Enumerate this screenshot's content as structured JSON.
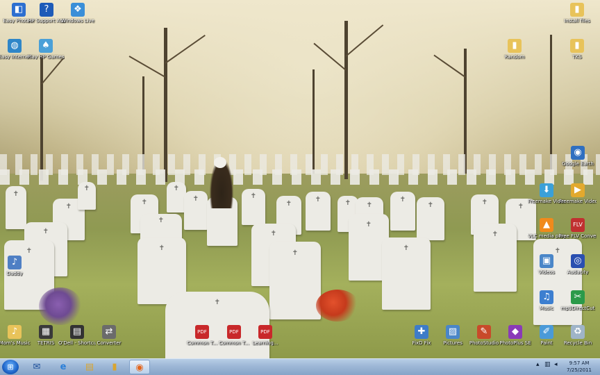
{
  "desktop_icons_left": [
    {
      "label": "Easy Photo...",
      "icon": "easy-photo-icon",
      "color": "#2d6fd0"
    },
    {
      "label": "HP Support Assistant",
      "icon": "hp-support-icon",
      "color": "#1e5bb8"
    },
    {
      "label": "Windows Live",
      "icon": "windows-live-icon",
      "color": "#3a8fd8"
    },
    {
      "label": "Easy Internet",
      "icon": "easy-internet-icon",
      "color": "#2f86c8"
    },
    {
      "label": "Play HP Games",
      "icon": "hp-games-icon",
      "color": "#4aa0d8"
    },
    {
      "label": "Daddy",
      "icon": "music-file-icon",
      "color": "#4f7fc4"
    }
  ],
  "desktop_icons_right": [
    {
      "label": "Install files",
      "icon": "folder-icon",
      "color": "#e8c35a"
    },
    {
      "label": "Random",
      "icon": "folder-icon",
      "color": "#e8c35a"
    },
    {
      "label": "TKS",
      "icon": "folder-icon",
      "color": "#e8c35a"
    },
    {
      "label": "Google Earth",
      "icon": "google-earth-icon",
      "color": "#2f6fc0"
    },
    {
      "label": "Freemake Video Dow...",
      "icon": "freemake-downloader-icon",
      "color": "#3aa0d8"
    },
    {
      "label": "Freemake Video Co...",
      "icon": "freemake-converter-icon",
      "color": "#e2a92e"
    },
    {
      "label": "VLC media player",
      "icon": "vlc-icon",
      "color": "#f08a1c"
    },
    {
      "label": "Free FLV Converter",
      "icon": "flv-converter-icon",
      "color": "#c03030"
    },
    {
      "label": "Videos",
      "icon": "videos-icon",
      "color": "#4a86c8"
    },
    {
      "label": "Audacity",
      "icon": "audacity-icon",
      "color": "#2a4fb0"
    },
    {
      "label": "Music",
      "icon": "music-icon",
      "color": "#3d7fd0"
    },
    {
      "label": "mp3DirectCut",
      "icon": "mp3-cut-icon",
      "color": "#2b9a4a"
    }
  ],
  "desktop_icons_bottom": [
    {
      "label": "Mom's Music",
      "icon": "folder-music-icon",
      "color": "#e8c35a"
    },
    {
      "label": "TETRIS",
      "icon": "tetris-icon",
      "color": "#3a3a3a"
    },
    {
      "label": "O'Dell - Shortcut",
      "icon": "shortcut-icon",
      "color": "#333333"
    },
    {
      "label": "Converter",
      "icon": "converter-icon",
      "color": "#6b6b6b"
    },
    {
      "label": "Common T...",
      "icon": "pdf-icon",
      "color": "#c8282a"
    },
    {
      "label": "Common T...",
      "icon": "pdf-icon",
      "color": "#c8282a"
    },
    {
      "label": "Learning...",
      "icon": "pdf-icon",
      "color": "#c8282a"
    },
    {
      "label": "FixD Fix",
      "icon": "fix-icon",
      "color": "#3e7cc8"
    },
    {
      "label": "Pictures",
      "icon": "pictures-icon",
      "color": "#4a86c8"
    },
    {
      "label": "PhotoStudio",
      "icon": "photostudio-icon",
      "color": "#c84a2a"
    },
    {
      "label": "PhotoPlus SE",
      "icon": "photoplus-icon",
      "color": "#8a3ab8"
    },
    {
      "label": "Paint",
      "icon": "paint-icon",
      "color": "#4a9ad8"
    },
    {
      "label": "Recycle Bin",
      "icon": "recycle-bin-icon",
      "color": "#9fb4c8"
    }
  ],
  "taskbar": {
    "start_icon": "windows-start-icon",
    "pinned": [
      {
        "name": "mail-icon",
        "glyph": "✉",
        "color": "#1d4f9a"
      },
      {
        "name": "internet-explorer-icon",
        "glyph": "e",
        "color": "#2b7fd8"
      },
      {
        "name": "windows-explorer-icon",
        "glyph": "▤",
        "color": "#d9a531"
      },
      {
        "name": "firefox-icon",
        "glyph": "◉",
        "color": "#e4651c"
      }
    ],
    "clock_time": "9:57 AM",
    "clock_date": "7/25/2011"
  }
}
